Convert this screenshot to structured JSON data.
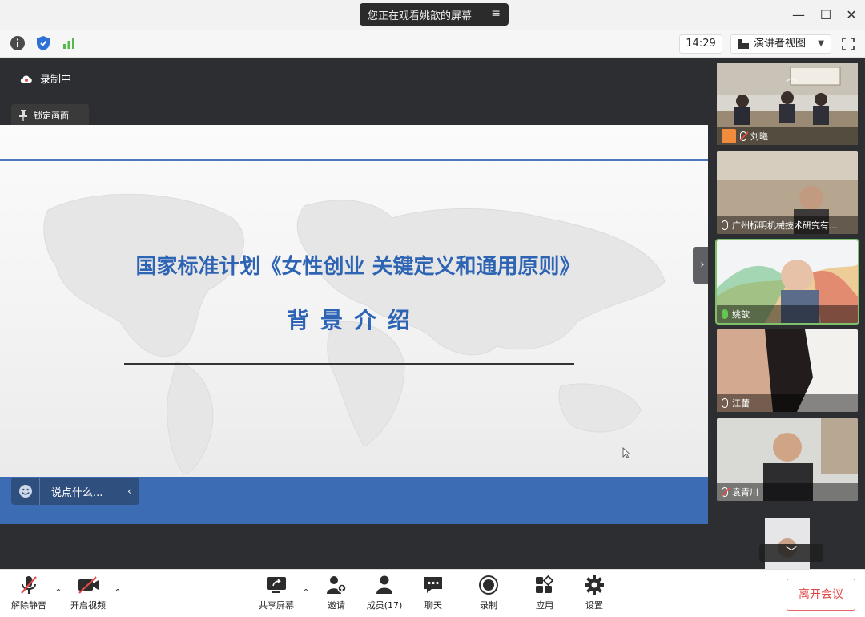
{
  "window": {
    "sharing_banner": "您正在观看姚歆的屏幕",
    "minimize_glyph": "—",
    "maximize_glyph": "☐",
    "close_glyph": "✕"
  },
  "infobar": {
    "clock": "14:29",
    "view_mode": "演讲者视图",
    "icons": [
      "info-icon",
      "shield-icon",
      "signal-icon",
      "fullscreen-icon"
    ]
  },
  "share": {
    "recording_label": "录制中",
    "lock_screen_label": "锁定画面",
    "slide_title": "国家标准计划《女性创业 关键定义和通用原则》",
    "slide_subtitle": "背景介绍",
    "chat_placeholder": "说点什么...",
    "chat_collapse_glyph": "‹",
    "panel_toggle_glyph": "›"
  },
  "participants": [
    {
      "name": "刘曦",
      "mic": "muted",
      "host": true
    },
    {
      "name": "广州标明机械技术研究有...",
      "mic": "on",
      "host": false
    },
    {
      "name": "姚歆",
      "mic": "speaking",
      "host": false
    },
    {
      "name": "江蕾",
      "mic": "on",
      "host": false
    },
    {
      "name": "袁青川",
      "mic": "muted",
      "host": false
    }
  ],
  "toolbar": {
    "unmute": "解除静音",
    "start_video": "开启视频",
    "share_screen": "共享屏幕",
    "invite": "邀请",
    "members": "成员(17)",
    "chat": "聊天",
    "record": "录制",
    "apps": "应用",
    "settings": "设置",
    "leave": "离开会议",
    "caret_glyph": "^"
  },
  "colors": {
    "accent_blue": "#2e64b4",
    "band_blue": "#3c6db4",
    "speaking_green": "#63c64f",
    "leave_red": "#e04848"
  }
}
